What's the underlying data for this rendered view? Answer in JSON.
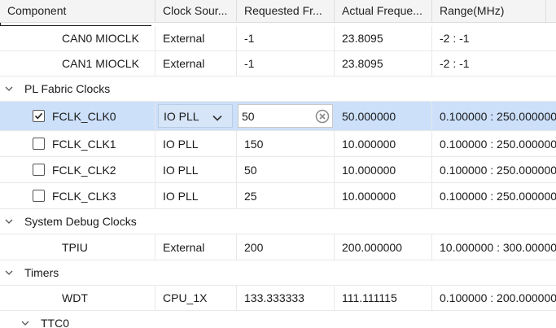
{
  "columns": [
    "Component",
    "Clock Sour...",
    "Requested Fr...",
    "Actual Freque...",
    "Range(MHz)"
  ],
  "rows": [
    {
      "type": "item",
      "name": "CAN0 MIOCLK",
      "source": "External",
      "requested": "-1",
      "actual": "23.8095",
      "range": "-2 : -1"
    },
    {
      "type": "item",
      "name": "CAN1 MIOCLK",
      "source": "External",
      "requested": "-1",
      "actual": "23.8095",
      "range": "-2 : -1"
    },
    {
      "type": "group",
      "name": "PL Fabric Clocks",
      "expanded": true
    },
    {
      "type": "item",
      "name": "FCLK_CLK0",
      "checkbox": true,
      "checked": true,
      "selected": true,
      "source": "IO PLL",
      "requested": "50",
      "actual": "50.000000",
      "range": "0.100000 : 250.000000"
    },
    {
      "type": "item",
      "name": "FCLK_CLK1",
      "checkbox": true,
      "checked": false,
      "source": "IO PLL",
      "requested": "150",
      "actual": "10.000000",
      "range": "0.100000 : 250.000000"
    },
    {
      "type": "item",
      "name": "FCLK_CLK2",
      "checkbox": true,
      "checked": false,
      "source": "IO PLL",
      "requested": "50",
      "actual": "10.000000",
      "range": "0.100000 : 250.000000"
    },
    {
      "type": "item",
      "name": "FCLK_CLK3",
      "checkbox": true,
      "checked": false,
      "source": "IO PLL",
      "requested": "25",
      "actual": "10.000000",
      "range": "0.100000 : 250.000000"
    },
    {
      "type": "group",
      "name": "System Debug Clocks",
      "expanded": true
    },
    {
      "type": "item",
      "name": "TPIU",
      "source": "External",
      "requested": "200",
      "actual": "200.000000",
      "range": "10.000000 : 300.000000"
    },
    {
      "type": "group",
      "name": "Timers",
      "expanded": true
    },
    {
      "type": "item",
      "name": "WDT",
      "source": "CPU_1X",
      "requested": "133.333333",
      "actual": "111.111115",
      "range": "0.100000 : 200.000000"
    },
    {
      "type": "subgroup",
      "name": "TTC0",
      "expanded": true
    }
  ],
  "colors": {
    "selected_row": "#cce0fa",
    "header_bg": "#f4f4f4"
  },
  "icons": {
    "expand": "chevron-down-icon",
    "clear": "clear-circle-icon",
    "dropdown": "dropdown-arrow-icon"
  }
}
